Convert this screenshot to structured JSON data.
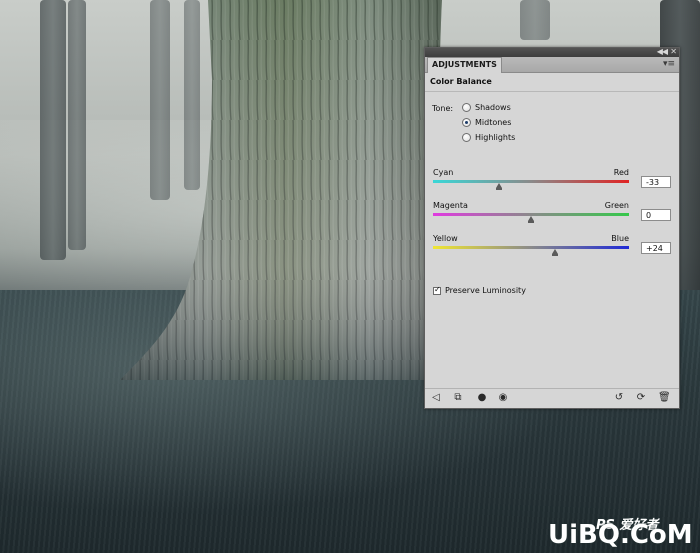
{
  "panel": {
    "tab_label": "ADJUSTMENTS",
    "title": "Color Balance",
    "tone": {
      "label": "Tone:",
      "options": [
        "Shadows",
        "Midtones",
        "Highlights"
      ],
      "selected": "Midtones"
    },
    "sliders": [
      {
        "left_label": "Cyan",
        "right_label": "Red",
        "value": "-33",
        "numeric": -33,
        "left_color": "#3ad7d7",
        "right_color": "#e02424"
      },
      {
        "left_label": "Magenta",
        "right_label": "Green",
        "value": "0",
        "numeric": 0,
        "left_color": "#e03ae0",
        "right_color": "#35c84a"
      },
      {
        "left_label": "Yellow",
        "right_label": "Blue",
        "value": "+24",
        "numeric": 24,
        "left_color": "#f0e633",
        "right_color": "#1f2ad6"
      }
    ],
    "preserve_luminosity": {
      "label": "Preserve Luminosity",
      "checked": true
    },
    "footer_icons": [
      "back-arrow-icon",
      "clip-to-layer-icon",
      "visibility-icon",
      "view-previous-icon",
      "reset-icon",
      "refresh-icon",
      "trash-icon"
    ]
  },
  "watermark": {
    "text": "UiBQ.CoM",
    "small": "PS 爱好者"
  }
}
